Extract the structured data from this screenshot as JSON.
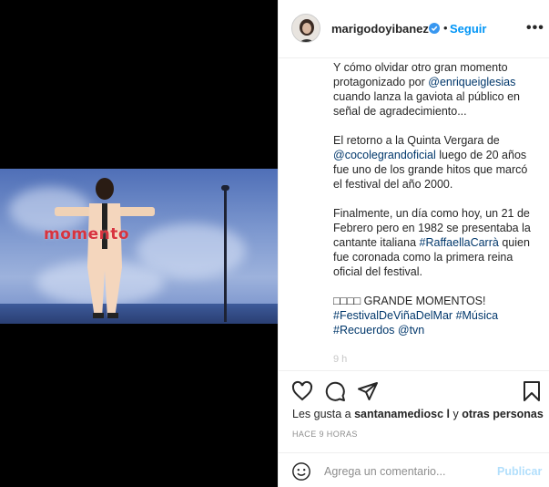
{
  "post": {
    "username": "marigodoyibanez",
    "separator": "•",
    "follow_label": "Seguir",
    "more_label": "•••",
    "video_watermark": "momento",
    "caption": {
      "p1_text": "Y cómo olvidar otro gran momento protagonizado por ",
      "p1_mention": "@enriqueiglesias",
      "p1_rest": " cuando lanza la gaviota al público en señal de agradecimiento...",
      "p2_text": "El retorno a la Quinta Vergara de ",
      "p2_mention": "@cocolegrandoficial",
      "p2_rest": " luego de 20 años fue uno de los grande hitos que marcó el festival del año 2000.",
      "p3_text": "Finalmente, un día como hoy, un 21 de Febrero pero en 1982 se presentaba la cantante italiana ",
      "p3_tag": "#RaffaellaCarrà",
      "p3_rest": " quien fue coronada como la primera reina oficial del festival.",
      "p4_text": "□□□□ GRANDE MOMENTOS!",
      "hashtag1": "#FestivalDeViñaDelMar",
      "hashtag2": "#Música",
      "hashtag3": "#Recuerdos",
      "mention_tvn": "@tvn",
      "faded": "9 h"
    },
    "likes": {
      "prefix": "Les gusta a ",
      "user": "santanamediosc l",
      "middle": " y ",
      "others": "otras personas"
    },
    "timestamp": "HACE 9 HORAS",
    "comment": {
      "placeholder": "Agrega un comentario...",
      "publish_label": "Publicar"
    }
  },
  "colors": {
    "accent": "#0095f6",
    "publish_disabled": "#b2dffc",
    "link": "#00376b",
    "watermark": "#d8343f"
  },
  "icons": [
    "verified-icon",
    "more-options-icon",
    "heart-icon",
    "comment-icon",
    "share-icon",
    "bookmark-icon",
    "emoji-icon"
  ]
}
